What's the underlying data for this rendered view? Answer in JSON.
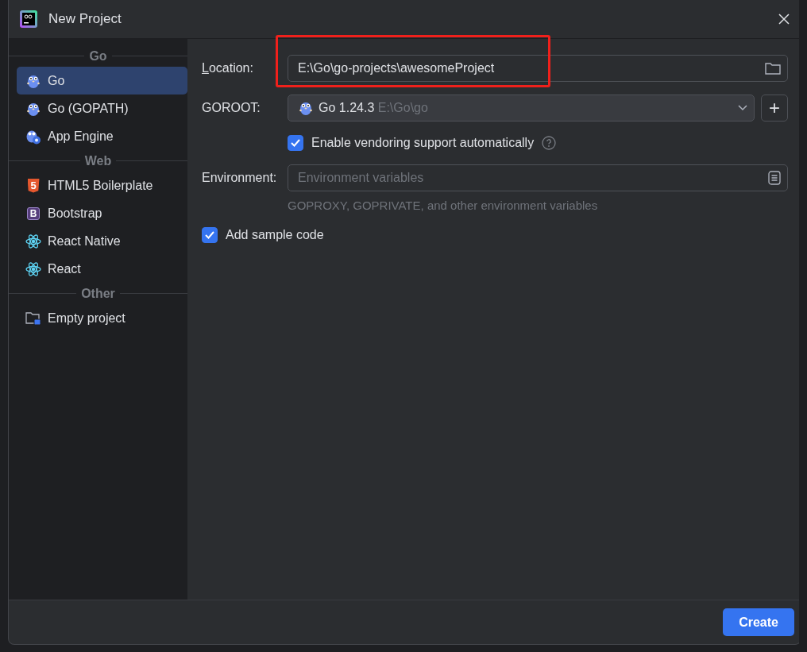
{
  "window": {
    "title": "New Project"
  },
  "sidebar": {
    "groups": [
      {
        "heading": "Go",
        "items": [
          {
            "label": "Go",
            "kind": "gopher",
            "selected": true
          },
          {
            "label": "Go (GOPATH)",
            "kind": "gopher",
            "selected": false
          },
          {
            "label": "App Engine",
            "kind": "appengine",
            "selected": false
          }
        ]
      },
      {
        "heading": "Web",
        "items": [
          {
            "label": "HTML5 Boilerplate",
            "kind": "html5",
            "icon_text": "5",
            "selected": false
          },
          {
            "label": "Bootstrap",
            "kind": "bootstrap",
            "icon_text": "B",
            "selected": false
          },
          {
            "label": "React Native",
            "kind": "react",
            "selected": false
          },
          {
            "label": "React",
            "kind": "react",
            "selected": false
          }
        ]
      },
      {
        "heading": "Other",
        "items": [
          {
            "label": "Empty project",
            "kind": "folder",
            "selected": false
          }
        ]
      }
    ]
  },
  "form": {
    "location": {
      "label": "Location:",
      "mnemonic_underline": true,
      "value": "E:\\Go\\go-projects\\awesomeProject",
      "highlighted": true
    },
    "goroot": {
      "label": "GOROOT:",
      "version": "Go 1.24.3",
      "path": "E:\\Go\\go",
      "add_symbol": "+"
    },
    "vendoring": {
      "label": "Enable vendoring support automatically",
      "checked": true
    },
    "environment": {
      "label": "Environment:",
      "placeholder": "Environment variables",
      "hint": "GOPROXY, GOPRIVATE, and other environment variables"
    },
    "sample_code": {
      "label": "Add sample code",
      "checked": true
    }
  },
  "buttons": [
    {
      "label": "Create",
      "kind": "primary"
    }
  ]
}
